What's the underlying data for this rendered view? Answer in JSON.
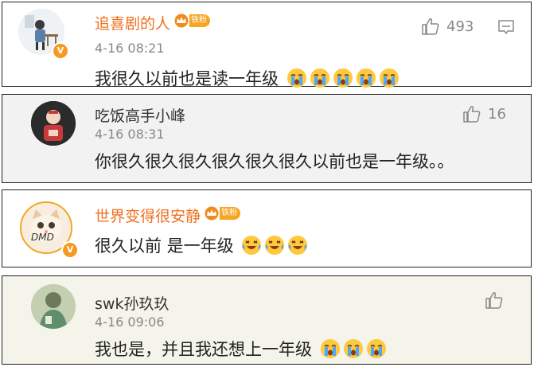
{
  "comments": [
    {
      "username": "追喜剧的人",
      "fan_badge": "铁粉",
      "time": "4-16 08:21",
      "text": "我很久以前也是读一年级",
      "emoji": "crying-face",
      "emoji_count": 5,
      "likes": "493",
      "verified_badge": "V",
      "name_color": "#f07020"
    },
    {
      "username": "吃饭高手小峰",
      "time": "4-16 08:31",
      "text": "你很久很久很久很久很久很久以前也是一年级。。",
      "likes": "16",
      "name_color": "#333333"
    },
    {
      "username": "世界变得很安静",
      "fan_badge": "铁粉",
      "time": "",
      "text": "很久以前 是一年级",
      "emoji": "laughing-tears-face",
      "emoji_count": 3,
      "verified_badge": "V",
      "avatar_text": "DMD",
      "name_color": "#f07020"
    },
    {
      "username": "swk孙玖玖",
      "time": "4-16 09:06",
      "text": "我也是，并且我还想上一年级",
      "emoji": "crying-face",
      "emoji_count": 3,
      "likes": "",
      "name_color": "#333333"
    }
  ]
}
